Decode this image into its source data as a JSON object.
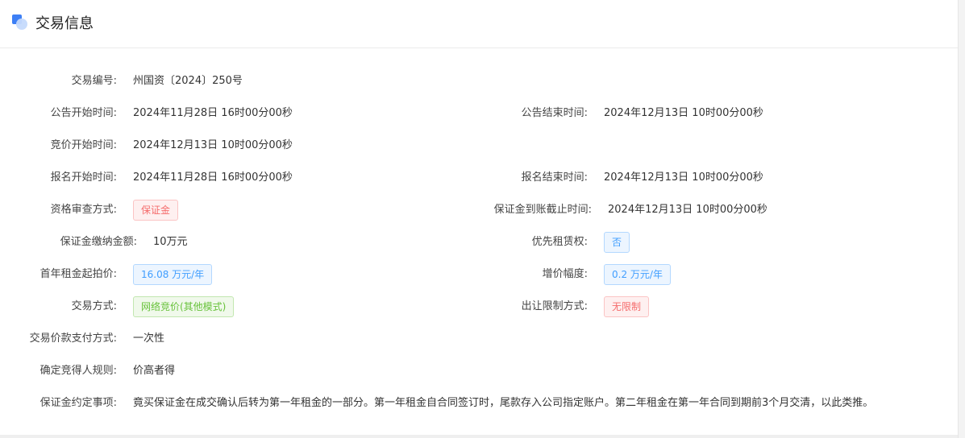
{
  "header": {
    "title": "交易信息",
    "icon": "section-icon"
  },
  "fields": {
    "trade_no": {
      "label": "交易编号:",
      "value": "州国资〔2024〕250号"
    },
    "notice_start": {
      "label": "公告开始时间:",
      "value": "2024年11月28日 16时00分00秒"
    },
    "notice_end": {
      "label": "公告结束时间:",
      "value": "2024年12月13日 10时00分00秒"
    },
    "bid_start": {
      "label": "竞价开始时间:",
      "value": "2024年12月13日 10时00分00秒"
    },
    "signup_start": {
      "label": "报名开始时间:",
      "value": "2024年11月28日 16时00分00秒"
    },
    "signup_end": {
      "label": "报名结束时间:",
      "value": "2024年12月13日 10时00分00秒"
    },
    "qualify_method": {
      "label": "资格审查方式:",
      "value": "保证金"
    },
    "deposit_deadline": {
      "label": "保证金到账截止时间:",
      "value": "2024年12月13日 10时00分00秒"
    },
    "deposit_amount": {
      "label": "保证金缴纳金额:",
      "value": "10万元"
    },
    "priority_lease": {
      "label": "优先租赁权:",
      "value": "否"
    },
    "first_year_rent": {
      "label": "首年租金起拍价:",
      "value": "16.08 万元/年"
    },
    "increment": {
      "label": "增价幅度:",
      "value": "0.2 万元/年"
    },
    "trade_method": {
      "label": "交易方式:",
      "value": "网络竞价(其他模式)"
    },
    "transfer_limit": {
      "label": "出让限制方式:",
      "value": "无限制"
    },
    "payment_method": {
      "label": "交易价款支付方式:",
      "value": "一次性"
    },
    "winner_rule": {
      "label": "确定竞得人规则:",
      "value": "价高者得"
    },
    "deposit_terms": {
      "label": "保证金约定事项:",
      "value": "竟买保证金在成交确认后转为第一年租金的一部分。第一年租金自合同签订时，尾款存入公司指定账户。第二年租金在第一年合同到期前3个月交清，以此类推。"
    }
  },
  "colors": {
    "tag_red": "#f56c6c",
    "tag_blue": "#409eff",
    "tag_green": "#67c23a",
    "accent": "#3d7ff5"
  }
}
